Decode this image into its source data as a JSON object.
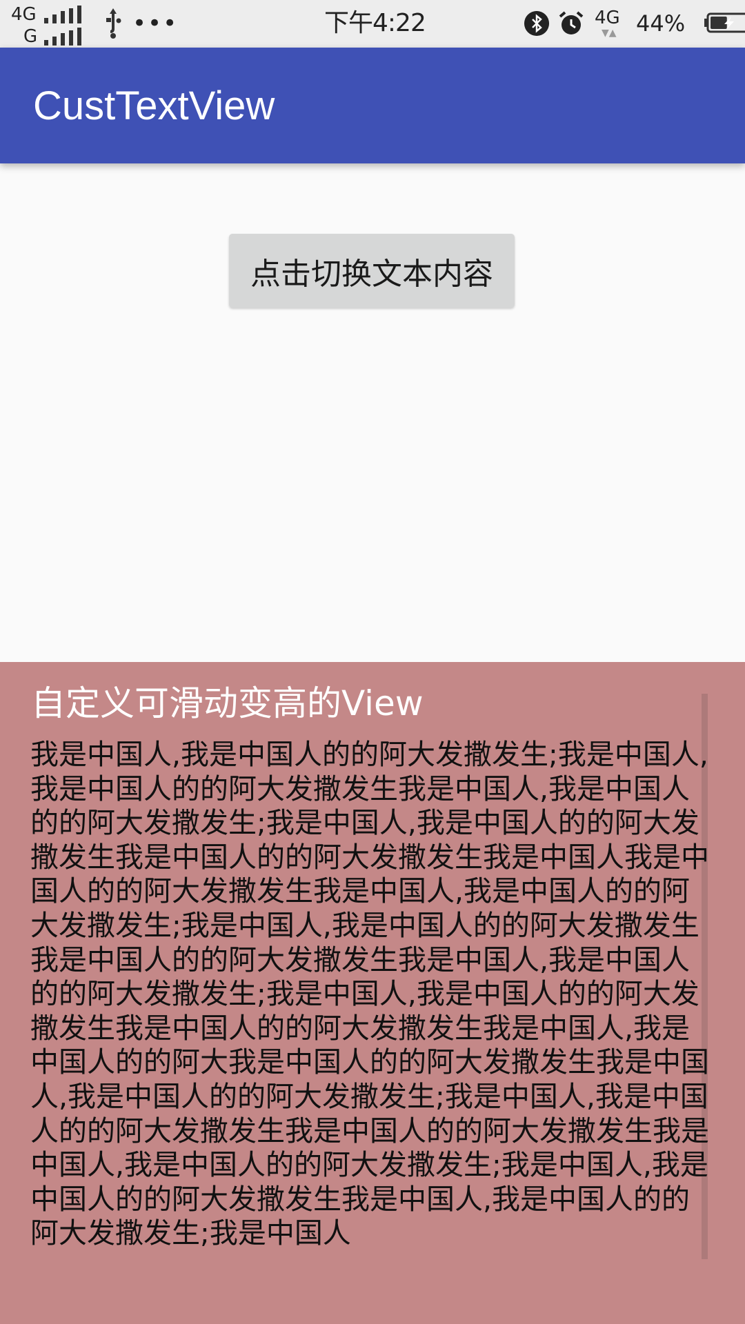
{
  "status_bar": {
    "network_top": "4G",
    "network_bottom": "G",
    "time": "下午4:22",
    "mobile_data": "4G",
    "battery_percent": "44%",
    "battery_level": 0.44
  },
  "app_bar": {
    "title": "CustTextView",
    "color": "#3f51b5"
  },
  "toggle_button": {
    "label": "点击切换文本内容"
  },
  "custom_view": {
    "title": "自定义可滑动变高的View",
    "body": "我是中国人,我是中国人的的阿大发撒发生;我是中国人,我是中国人的的阿大发撒发生我是中国人,我是中国人的的阿大发撒发生;我是中国人,我是中国人的的阿大发撒发生我是中国人的的阿大发撒发生我是中国人我是中国人的的阿大发撒发生我是中国人,我是中国人的的阿大发撒发生;我是中国人,我是中国人的的阿大发撒发生我是中国人的的阿大发撒发生我是中国人,我是中国人的的阿大发撒发生;我是中国人,我是中国人的的阿大发撒发生我是中国人的的阿大发撒发生我是中国人,我是中国人的的阿大我是中国人的的阿大发撒发生我是中国人,我是中国人的的阿大发撒发生;我是中国人,我是中国人的的阿大发撒发生我是中国人的的阿大发撒发生我是中国人,我是中国人的的阿大发撒发生;我是中国人,我是中国人的的阿大发撒发生我是中国人,我是中国人的的阿大发撒发生;我是中国人",
    "background_color": "#c48888"
  }
}
